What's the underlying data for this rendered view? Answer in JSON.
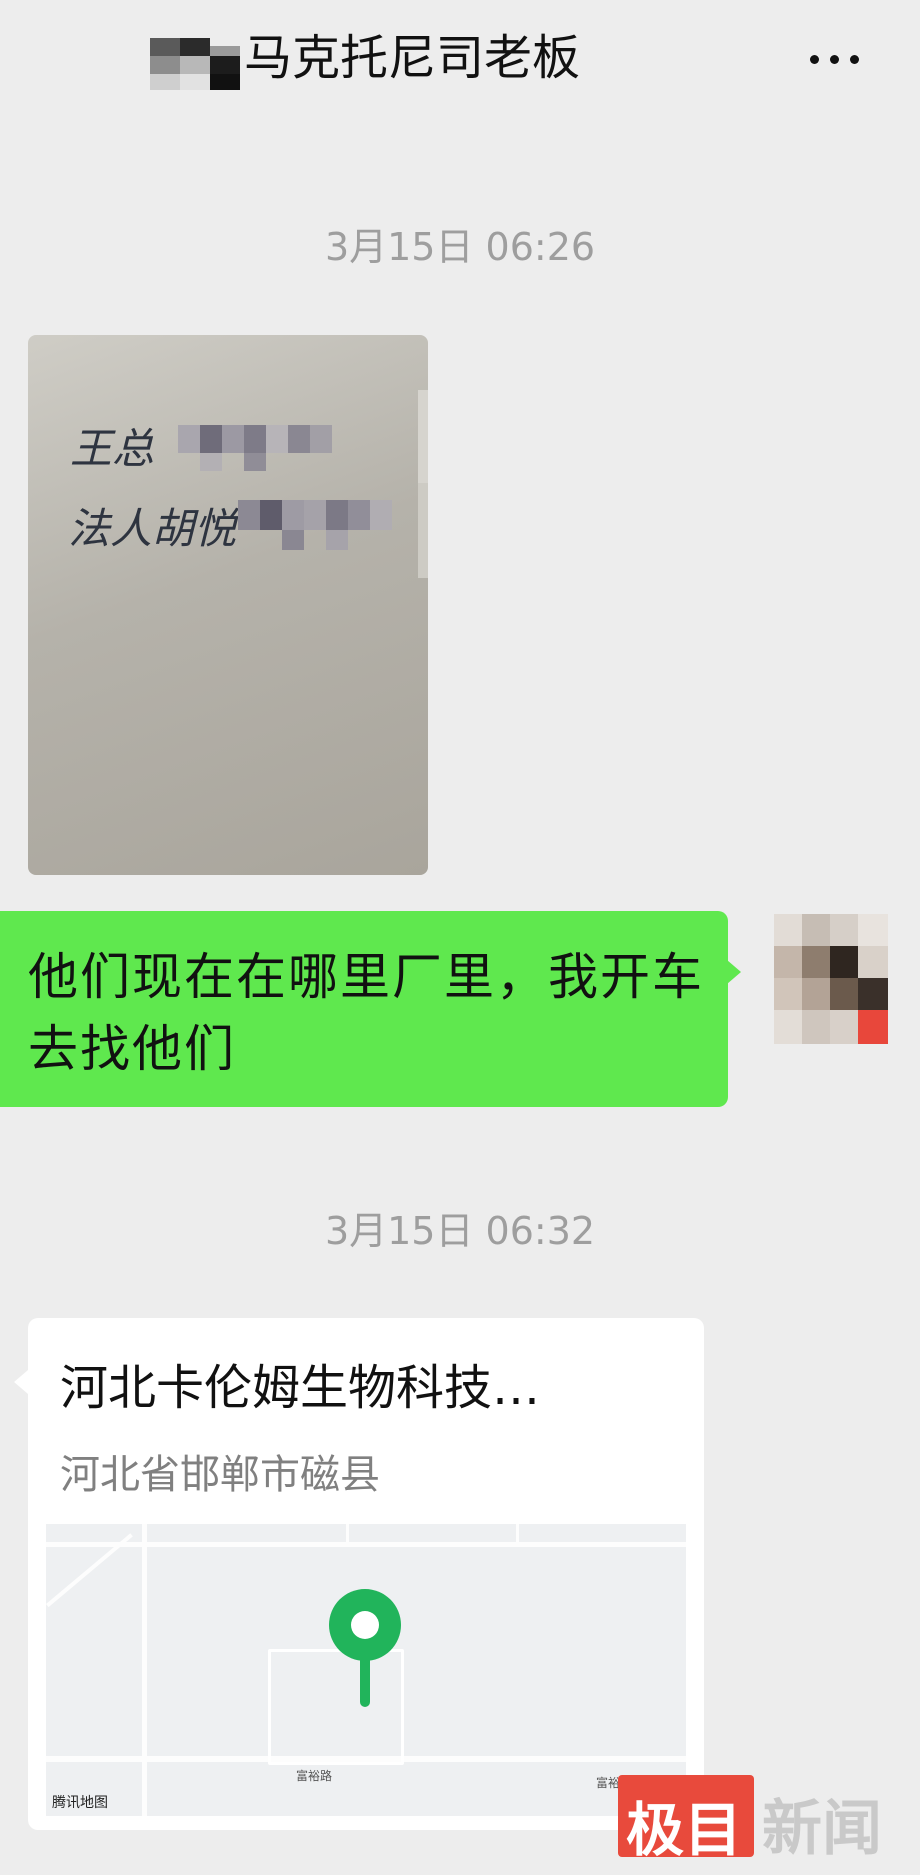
{
  "header": {
    "title": "马克托尼司老板",
    "more_label": "···"
  },
  "messages": {
    "time1": "3月15日 06:26",
    "photo_line1": "王总",
    "photo_line2": "法人胡悦",
    "my_text": "他们现在在哪里厂里，我开车去找他们",
    "time2": "3月15日 06:32",
    "location": {
      "name": "河北卡伦姆生物科技…",
      "address": "河北省邯郸市磁县",
      "road_label_1": "富裕路",
      "road_label_2": "富裕路",
      "map_credit": "腾讯地图"
    }
  },
  "watermark": {
    "box": "极目",
    "text": "新闻"
  },
  "colors": {
    "background": "#ededed",
    "my_bubble": "#5fe84e",
    "pin": "#21b45b",
    "watermark_red": "#e84a3c"
  }
}
